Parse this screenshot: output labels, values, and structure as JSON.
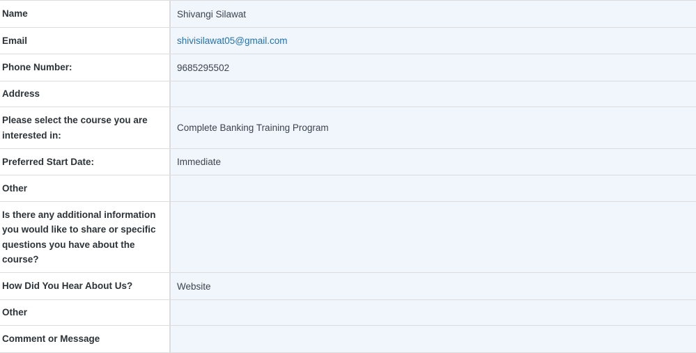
{
  "entry": {
    "fields": [
      {
        "label": "Name",
        "value": "Shivangi Silawat"
      },
      {
        "label": "Email",
        "value": "shivisilawat05@gmail.com",
        "link": true
      },
      {
        "label": "Phone Number:",
        "value": "9685295502"
      },
      {
        "label": "Address",
        "value": ""
      },
      {
        "label": "Please select the course you are interested in:",
        "value": "Complete Banking Training Program"
      },
      {
        "label": "Preferred Start Date:",
        "value": "Immediate"
      },
      {
        "label": "Other",
        "value": ""
      },
      {
        "label": "Is there any additional information you would like to share or specific questions you have about the course?",
        "value": ""
      },
      {
        "label": "How Did You Hear About Us?",
        "value": "Website"
      },
      {
        "label": "Other",
        "value": ""
      },
      {
        "label": "Comment or Message",
        "value": ""
      }
    ]
  },
  "colors": {
    "label_bg": "#ffffff",
    "value_bg": "#f0f6fc",
    "border": "#dcdcde",
    "link": "#2271b1",
    "text": "#2c3338"
  }
}
